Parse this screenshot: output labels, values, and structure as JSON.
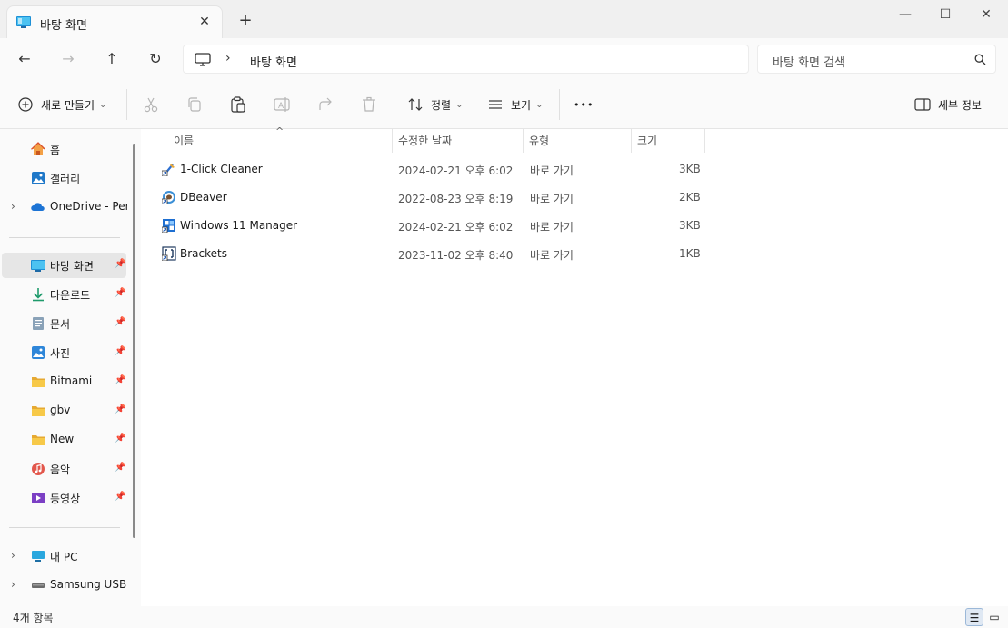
{
  "window": {
    "tab_title": "바탕 화면",
    "tab_close_glyph": "✕",
    "new_tab_glyph": "+",
    "minimize_glyph": "—",
    "maximize_glyph": "☐",
    "close_glyph": "✕"
  },
  "nav": {
    "back_glyph": "←",
    "forward_glyph": "→",
    "up_glyph": "↑",
    "refresh_glyph": "↻"
  },
  "address": {
    "separator": "›",
    "location": "바탕 화면",
    "search_placeholder": "바탕 화면 검색"
  },
  "toolbar": {
    "new_label": "새로 만들기",
    "sort_label": "정렬",
    "view_label": "보기",
    "more_glyph": "•••",
    "details_label": "세부 정보",
    "dropdown_glyph": "⌄",
    "cut_icon": "scissors-icon",
    "copy_icon": "copy-icon",
    "paste_icon": "paste-icon",
    "rename_icon": "rename-icon",
    "share_icon": "share-icon",
    "delete_icon": "trash-icon"
  },
  "sidebar": {
    "expand_glyph": "›",
    "pin_glyph": "📌",
    "top_items": [
      {
        "label": "홈",
        "icon": "home-icon"
      },
      {
        "label": "갤러리",
        "icon": "gallery-icon"
      },
      {
        "label": "OneDrive - Pers",
        "icon": "onedrive-icon"
      }
    ],
    "quick_items": [
      {
        "label": "바탕 화면",
        "icon": "desktop-icon"
      },
      {
        "label": "다운로드",
        "icon": "download-icon"
      },
      {
        "label": "문서",
        "icon": "document-icon"
      },
      {
        "label": "사진",
        "icon": "pictures-icon"
      },
      {
        "label": "Bitnami",
        "icon": "folder-icon"
      },
      {
        "label": "gbv",
        "icon": "folder-icon"
      },
      {
        "label": "New",
        "icon": "folder-icon"
      },
      {
        "label": "음악",
        "icon": "music-icon"
      },
      {
        "label": "동영상",
        "icon": "video-icon"
      }
    ],
    "bottom_items": [
      {
        "label": "내 PC",
        "icon": "pc-icon"
      },
      {
        "label": "Samsung USB (",
        "icon": "usb-drive-icon"
      }
    ]
  },
  "table": {
    "sort_glyph": "^",
    "columns": [
      "이름",
      "수정한 날짜",
      "유형",
      "크기"
    ],
    "rows": [
      {
        "name": "1-Click Cleaner",
        "date": "2024-02-21 오후 6:02",
        "type": "바로 가기",
        "size": "3KB"
      },
      {
        "name": "DBeaver",
        "date": "2022-08-23 오후 8:19",
        "type": "바로 가기",
        "size": "2KB"
      },
      {
        "name": "Windows 11 Manager",
        "date": "2024-02-21 오후 6:02",
        "type": "바로 가기",
        "size": "3KB"
      },
      {
        "name": "Brackets",
        "date": "2023-11-02 오후 8:40",
        "type": "바로 가기",
        "size": "1KB"
      }
    ]
  },
  "status": {
    "count": "4개 항목",
    "details_view_glyph": "☰",
    "tiles_view_glyph": "▭"
  },
  "colors": {
    "accent": "#0067c0",
    "folder": "#f7c948"
  }
}
